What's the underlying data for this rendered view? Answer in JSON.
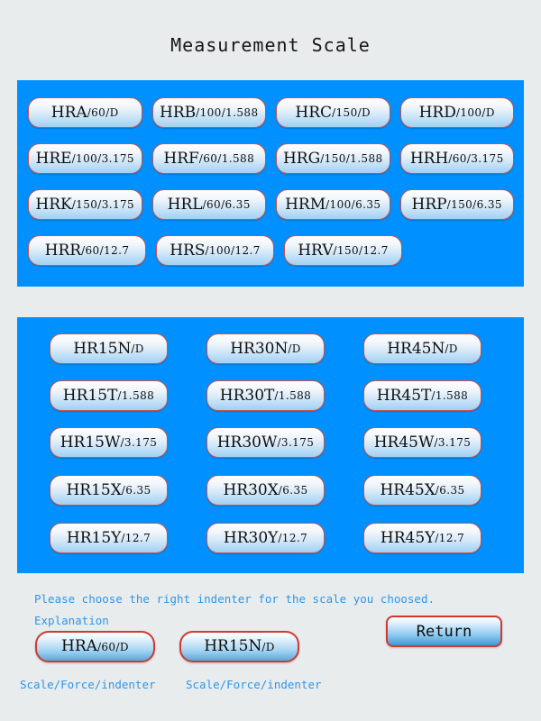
{
  "header": {
    "title": "Measurement Scale"
  },
  "panels": {
    "regular": {
      "rows": [
        [
          {
            "code": "HRA",
            "spec": "/60/D"
          },
          {
            "code": "HRB",
            "spec": "/100/1.588"
          },
          {
            "code": "HRC",
            "spec": "/150/D"
          },
          {
            "code": "HRD",
            "spec": "/100/D"
          }
        ],
        [
          {
            "code": "HRE",
            "spec": "/100/3.175"
          },
          {
            "code": "HRF",
            "spec": "/60/1.588"
          },
          {
            "code": "HRG",
            "spec": "/150/1.588"
          },
          {
            "code": "HRH",
            "spec": "/60/3.175"
          }
        ],
        [
          {
            "code": "HRK",
            "spec": "/150/3.175"
          },
          {
            "code": "HRL",
            "spec": "/60/6.35"
          },
          {
            "code": "HRM",
            "spec": "/100/6.35"
          },
          {
            "code": "HRP",
            "spec": "/150/6.35"
          }
        ],
        [
          {
            "code": "HRR",
            "spec": "/60/12.7"
          },
          {
            "code": "HRS",
            "spec": "/100/12.7"
          },
          {
            "code": "HRV",
            "spec": "/150/12.7"
          }
        ]
      ]
    },
    "superficial": {
      "rows": [
        [
          {
            "code": "HR15N",
            "spec": "/D"
          },
          {
            "code": "HR30N",
            "spec": "/D"
          },
          {
            "code": "HR45N",
            "spec": "/D"
          }
        ],
        [
          {
            "code": "HR15T",
            "spec": "/1.588"
          },
          {
            "code": "HR30T",
            "spec": "/1.588"
          },
          {
            "code": "HR45T",
            "spec": "/1.588"
          }
        ],
        [
          {
            "code": "HR15W",
            "spec": "/3.175"
          },
          {
            "code": "HR30W",
            "spec": "/3.175"
          },
          {
            "code": "HR45W",
            "spec": "/3.175"
          }
        ],
        [
          {
            "code": "HR15X",
            "spec": "/6.35"
          },
          {
            "code": "HR30X",
            "spec": "/6.35"
          },
          {
            "code": "HR45X",
            "spec": "/6.35"
          }
        ],
        [
          {
            "code": "HR15Y",
            "spec": "/12.7"
          },
          {
            "code": "HR30Y",
            "spec": "/12.7"
          },
          {
            "code": "HR45Y",
            "spec": "/12.7"
          }
        ]
      ]
    }
  },
  "footer": {
    "hint_line1": "Please choose the right indenter for the scale you choosed.",
    "hint_line2": "Explanation",
    "example_left": {
      "code": "HRA",
      "spec": "/60/D",
      "legend": "Scale/Force/indenter"
    },
    "example_right": {
      "code": "HR15N",
      "spec": "/D",
      "legend": "Scale/Force/indenter"
    },
    "return_label": "Return"
  },
  "colors": {
    "page_background": "#e8eced",
    "panel_blue": "#0090ff",
    "button_border": "#c4544e",
    "accent_red": "#cf3a33",
    "hint_blue": "#2f96e8"
  }
}
